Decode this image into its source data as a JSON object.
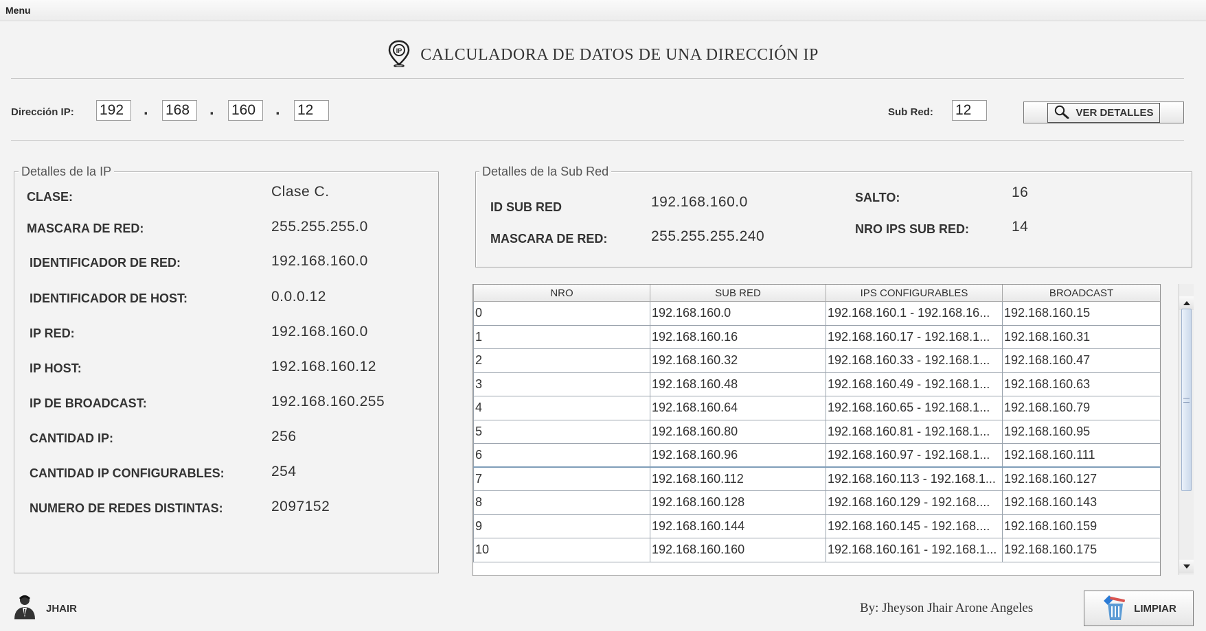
{
  "menubar": {
    "menu_label": "Menu"
  },
  "header": {
    "title": "CALCULADORA DE DATOS DE UNA DIRECCIÓN IP",
    "icon_text": "IP"
  },
  "input": {
    "ip_label": "Dirección IP:",
    "octets": [
      "192",
      "168",
      "160",
      "12"
    ],
    "dot": ".",
    "subnet_label": "Sub Red:",
    "subnet_value": "12",
    "details_button": "VER DETALLES"
  },
  "ip_details": {
    "legend": "Detalles de la IP",
    "rows": [
      {
        "label": "CLASE:",
        "value": "Clase C."
      },
      {
        "label": "MASCARA DE RED:",
        "value": "255.255.255.0"
      },
      {
        "label": "IDENTIFICADOR DE RED:",
        "value": "192.168.160.0"
      },
      {
        "label": "IDENTIFICADOR DE HOST:",
        "value": "0.0.0.12"
      },
      {
        "label": "IP RED:",
        "value": "192.168.160.0"
      },
      {
        "label": "IP HOST:",
        "value": "192.168.160.12"
      },
      {
        "label": "IP DE BROADCAST:",
        "value": "192.168.160.255"
      },
      {
        "label": "CANTIDAD IP:",
        "value": "256"
      },
      {
        "label": "CANTIDAD IP CONFIGURABLES:",
        "value": "254"
      },
      {
        "label": "NUMERO DE REDES DISTINTAS:",
        "value": "2097152"
      }
    ]
  },
  "subnet_details": {
    "legend": "Detalles de la Sub Red",
    "id_label": "ID SUB RED",
    "id_value": "192.168.160.0",
    "mask_label": "MASCARA DE RED:",
    "mask_value": "255.255.255.240",
    "jump_label": "SALTO:",
    "jump_value": "16",
    "ips_label": "NRO IPS SUB RED:",
    "ips_value": "14"
  },
  "table": {
    "columns": [
      "NRO",
      "SUB RED",
      "IPS CONFIGURABLES",
      "BROADCAST"
    ],
    "rows": [
      [
        "0",
        "192.168.160.0",
        "192.168.160.1 - 192.168.16...",
        "192.168.160.15"
      ],
      [
        "1",
        "192.168.160.16",
        "192.168.160.17 - 192.168.1...",
        "192.168.160.31"
      ],
      [
        "2",
        "192.168.160.32",
        "192.168.160.33 - 192.168.1...",
        "192.168.160.47"
      ],
      [
        "3",
        "192.168.160.48",
        "192.168.160.49 - 192.168.1...",
        "192.168.160.63"
      ],
      [
        "4",
        "192.168.160.64",
        "192.168.160.65 - 192.168.1...",
        "192.168.160.79"
      ],
      [
        "5",
        "192.168.160.80",
        "192.168.160.81 - 192.168.1...",
        "192.168.160.95"
      ],
      [
        "6",
        "192.168.160.96",
        "192.168.160.97 - 192.168.1...",
        "192.168.160.111"
      ],
      [
        "7",
        "192.168.160.112",
        "192.168.160.113 - 192.168.1...",
        "192.168.160.127"
      ],
      [
        "8",
        "192.168.160.128",
        "192.168.160.129 - 192.168....",
        "192.168.160.143"
      ],
      [
        "9",
        "192.168.160.144",
        "192.168.160.145 - 192.168....",
        "192.168.160.159"
      ],
      [
        "10",
        "192.168.160.160",
        "192.168.160.161 - 192.168.1...",
        "192.168.160.175"
      ]
    ],
    "selected_row_index": 7
  },
  "footer": {
    "user_label": "JHAIR",
    "author": "By: Jheyson Jhair Arone Angeles",
    "clear_button": "LIMPIAR"
  },
  "icons": {
    "title": "location-pin-ip-icon",
    "search": "magnifier-icon",
    "user": "user-suit-icon",
    "clear": "trash-bin-icon"
  }
}
